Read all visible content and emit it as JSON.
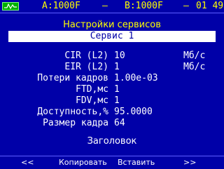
{
  "topbar": {
    "icon": "signal-icon",
    "channel_a": "A:1000F",
    "sep1": "–",
    "channel_b": "B:1000F",
    "sep2": "–",
    "time": "01 49"
  },
  "title": "Настройки сервисов",
  "service": "Сервис 1",
  "params": [
    {
      "label": "CIR (L2)",
      "value": "10",
      "unit": "Мб/с"
    },
    {
      "label": "EIR (L2)",
      "value": "1",
      "unit": "Мб/с"
    },
    {
      "label": "Потери кадров",
      "value": "1.00e-03",
      "unit": ""
    },
    {
      "label": "FTD,мс",
      "value": "1",
      "unit": ""
    },
    {
      "label": "FDV,мс",
      "value": "1",
      "unit": ""
    },
    {
      "label": "Доступность,%",
      "value": "95.0000",
      "unit": ""
    },
    {
      "label": "Размер кадра",
      "value": "64",
      "unit": ""
    }
  ],
  "header_item": "Заголовок",
  "softkeys": {
    "prev": "<<",
    "copy": "Копировать",
    "paste": "Вставить",
    "next": ">>"
  },
  "colors": {
    "background": "#0000a8",
    "accent": "#ffff00",
    "text": "#ffffff"
  }
}
